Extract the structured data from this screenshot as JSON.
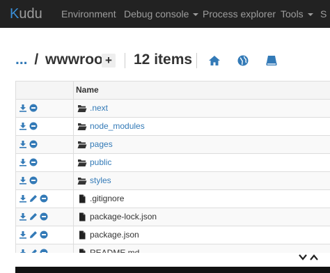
{
  "nav": {
    "brand": "Kudu",
    "items": [
      {
        "label": "Environment"
      },
      {
        "label": "Debug console"
      },
      {
        "label": "Process explorer"
      },
      {
        "label": "Tools"
      },
      {
        "label": "S"
      }
    ]
  },
  "breadcrumb": {
    "parent": "...",
    "separator": "/",
    "current": "wwwroot",
    "add_label": "+"
  },
  "item_count": "12 items",
  "header_icons": [
    "home-icon",
    "globe-icon",
    "drive-icon"
  ],
  "table": {
    "column_name": "Name",
    "rows": [
      {
        "name": ".next",
        "type": "folder"
      },
      {
        "name": "node_modules",
        "type": "folder"
      },
      {
        "name": "pages",
        "type": "folder"
      },
      {
        "name": "public",
        "type": "folder"
      },
      {
        "name": "styles",
        "type": "folder"
      },
      {
        "name": ".gitignore",
        "type": "file"
      },
      {
        "name": "package-lock.json",
        "type": "file"
      },
      {
        "name": "package.json",
        "type": "file"
      },
      {
        "name": "README.md",
        "type": "file"
      }
    ]
  },
  "colors": {
    "navbar": "#222222",
    "nav_text": "#9d9d9d",
    "link": "#337ab7",
    "brand_k": "#3a8fd8"
  }
}
